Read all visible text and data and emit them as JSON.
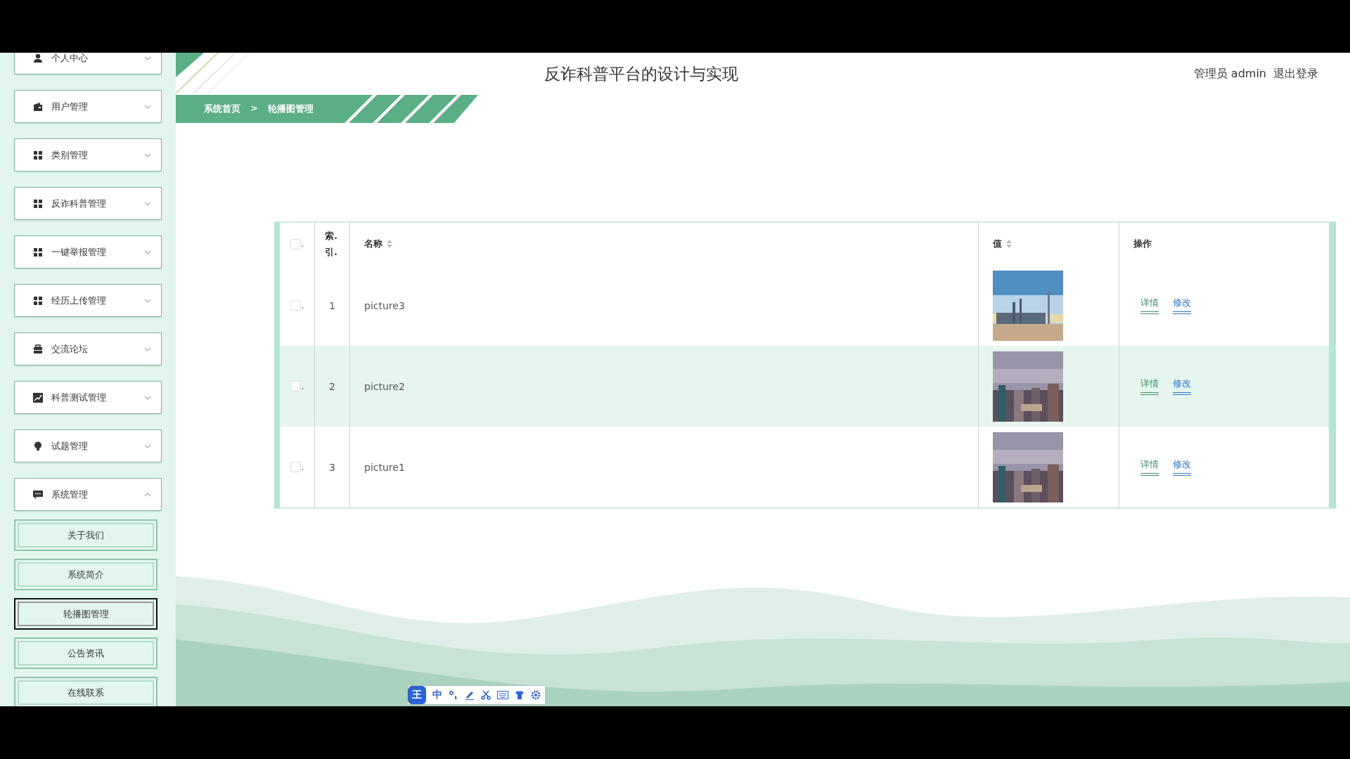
{
  "header": {
    "title": "反诈科普平台的设计与实现",
    "user_label": "管理员 admin",
    "logout": "退出登录"
  },
  "breadcrumb": [
    {
      "label": "系统首页"
    },
    {
      "label": ">"
    },
    {
      "label": "轮播图管理"
    }
  ],
  "sidebar": {
    "items": [
      {
        "label": "个人中心",
        "expanded": false
      },
      {
        "label": "用户管理",
        "expanded": false
      },
      {
        "label": "类别管理",
        "expanded": false
      },
      {
        "label": "反诈科普管理",
        "expanded": false
      },
      {
        "label": "一键举报管理",
        "expanded": false
      },
      {
        "label": "经历上传管理",
        "expanded": false
      },
      {
        "label": "交流论坛",
        "expanded": false
      },
      {
        "label": "科普测试管理",
        "expanded": false
      },
      {
        "label": "试题管理",
        "expanded": false
      },
      {
        "label": "系统管理",
        "expanded": true,
        "children": [
          {
            "label": "关于我们",
            "selected": false
          },
          {
            "label": "系统简介",
            "selected": false
          },
          {
            "label": "轮播图管理",
            "selected": true
          },
          {
            "label": "公告资讯",
            "selected": false
          },
          {
            "label": "在线联系",
            "selected": false
          }
        ]
      }
    ]
  },
  "table": {
    "columns": [
      {
        "label": "索. 引.",
        "sortable": false
      },
      {
        "label": "名称",
        "sortable": true
      },
      {
        "label": "值",
        "sortable": true
      },
      {
        "label": "操作",
        "sortable": false
      }
    ],
    "header_check": {
      "checked": false,
      "mark": "."
    },
    "rows": [
      {
        "checked": false,
        "mark": ".",
        "index": "1",
        "name": "picture3",
        "value": {
          "kind": "picture"
        },
        "hovered": false,
        "actions": [
          "详情",
          "修改"
        ]
      },
      {
        "checked": false,
        "mark": ".",
        "index": "2",
        "name": "picture2",
        "value": {
          "kind": "picture"
        },
        "hovered": true,
        "actions": [
          "详情",
          "修改"
        ]
      },
      {
        "checked": false,
        "mark": ".",
        "index": "3",
        "name": "picture1",
        "value": {
          "kind": "picture"
        },
        "hovered": false,
        "actions": [
          "详情",
          "修改"
        ]
      }
    ]
  },
  "ime_toolbar": {
    "logo": "王",
    "mode": "中"
  }
}
